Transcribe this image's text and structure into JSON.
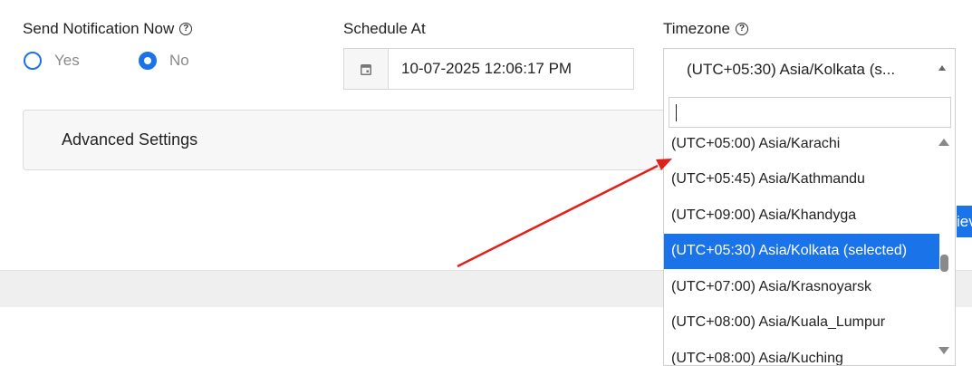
{
  "send_notification": {
    "label": "Send Notification Now",
    "help_icon": "?",
    "options": [
      {
        "label": "Yes",
        "checked": false
      },
      {
        "label": "No",
        "checked": true
      }
    ]
  },
  "schedule": {
    "label": "Schedule At",
    "icon": "calendar-icon",
    "value": "10-07-2025 12:06:17 PM"
  },
  "timezone": {
    "label": "Timezone",
    "help_icon": "?",
    "selected_display": "(UTC+05:30) Asia/Kolkata (s...",
    "search_value": "",
    "options": [
      {
        "label": "(UTC+05:00) Asia/Karachi",
        "selected": false
      },
      {
        "label": "(UTC+05:45) Asia/Kathmandu",
        "selected": false
      },
      {
        "label": "(UTC+09:00) Asia/Khandyga",
        "selected": false
      },
      {
        "label": "(UTC+05:30) Asia/Kolkata (selected)",
        "selected": true
      },
      {
        "label": "(UTC+07:00) Asia/Krasnoyarsk",
        "selected": false
      },
      {
        "label": "(UTC+08:00) Asia/Kuala_Lumpur",
        "selected": false
      },
      {
        "label": "(UTC+08:00) Asia/Kuching",
        "selected": false
      }
    ]
  },
  "advanced_settings": {
    "label": "Advanced Settings"
  },
  "partial_button": {
    "label": "iev"
  },
  "colors": {
    "accent": "#1a73e8",
    "annotation_arrow": "#e0201b"
  }
}
